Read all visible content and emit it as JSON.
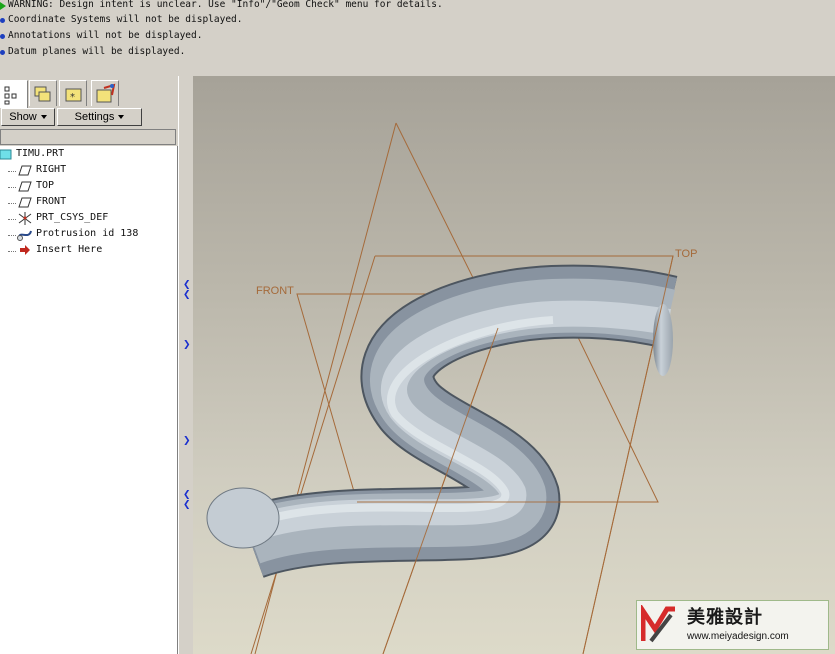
{
  "messages": [
    {
      "text": "WARNING: Design intent is unclear.  Use \"Info\"/\"Geom Check\" menu for details.",
      "kind": "warning"
    },
    {
      "text": "Coordinate Systems will not be displayed.",
      "kind": "info"
    },
    {
      "text": "Annotations will not be displayed.",
      "kind": "info"
    },
    {
      "text": "Datum planes will be displayed.",
      "kind": "info"
    }
  ],
  "tabs": [
    {
      "icon": "model-tree-icon"
    },
    {
      "icon": "folder-browser-icon"
    },
    {
      "icon": "favorites-folder-icon"
    },
    {
      "icon": "connections-icon"
    }
  ],
  "toolbar": {
    "show_label": "Show",
    "settings_label": "Settings"
  },
  "tree": {
    "root": "TIMU.PRT",
    "items": [
      {
        "label": "RIGHT",
        "icon": "datum-plane-icon"
      },
      {
        "label": "TOP",
        "icon": "datum-plane-icon"
      },
      {
        "label": "FRONT",
        "icon": "datum-plane-icon"
      },
      {
        "label": "PRT_CSYS_DEF",
        "icon": "coordinate-system-icon"
      },
      {
        "label": "Protrusion id 138",
        "icon": "sweep-protrusion-icon"
      },
      {
        "label": "Insert Here",
        "icon": "insert-arrow-icon"
      }
    ]
  },
  "viewport": {
    "plane_labels": {
      "top": "TOP",
      "front": "FRONT"
    },
    "datum_color": "#a56a3a",
    "tube_color": "#aab4bd"
  },
  "watermark": {
    "brand": "美雅設計",
    "url": "www.meiyadesign.com"
  },
  "colors": {
    "accent_blue": "#1a2fcf",
    "warning_green": "#1aa51a",
    "panel_bg": "#d4d0c8"
  }
}
